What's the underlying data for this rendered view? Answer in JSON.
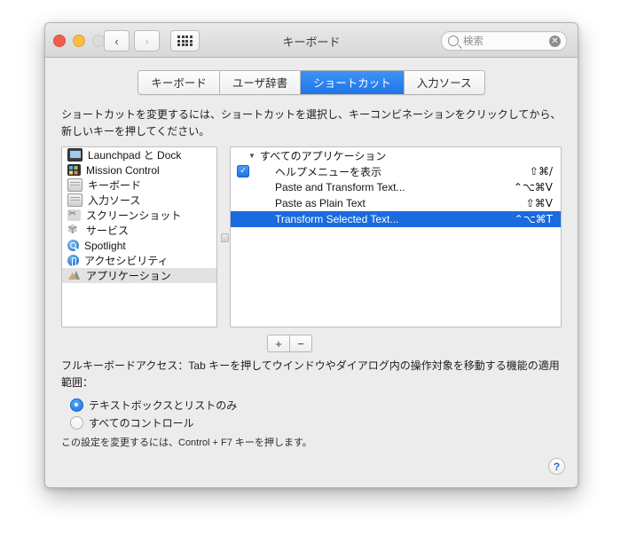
{
  "window": {
    "title": "キーボード",
    "traffic_lights": [
      "close",
      "minimize",
      "zoom"
    ],
    "nav": {
      "back_icon": "‹",
      "forward_icon": "›",
      "grid_icon": "grid-icon"
    },
    "search": {
      "placeholder": "検索",
      "value": "",
      "clear_label": "✕"
    }
  },
  "tabs": [
    {
      "label": "キーボード",
      "active": false
    },
    {
      "label": "ユーザ辞書",
      "active": false
    },
    {
      "label": "ショートカット",
      "active": true
    },
    {
      "label": "入力ソース",
      "active": false
    }
  ],
  "description": "ショートカットを変更するには、ショートカットを選択し、キーコンビネーションをクリックしてから、新しいキーを押してください。",
  "sidebar": {
    "items": [
      {
        "label": "Launchpad と Dock",
        "icon": "laptop-icon",
        "selected": false
      },
      {
        "label": "Mission Control",
        "icon": "mission-control-icon",
        "selected": false
      },
      {
        "label": "キーボード",
        "icon": "keyboard-icon",
        "selected": false
      },
      {
        "label": "入力ソース",
        "icon": "keyboard-icon",
        "selected": false
      },
      {
        "label": "スクリーンショット",
        "icon": "screenshot-icon",
        "selected": false
      },
      {
        "label": "サービス",
        "icon": "gear-icon",
        "selected": false
      },
      {
        "label": "Spotlight",
        "icon": "spotlight-icon",
        "selected": false
      },
      {
        "label": "アクセシビリティ",
        "icon": "accessibility-icon",
        "selected": false
      },
      {
        "label": "アプリケーション",
        "icon": "application-icon",
        "selected": true
      }
    ]
  },
  "shortcut_list": {
    "group_header": "すべてのアプリケーション",
    "disclosure_icon": "▼",
    "rows": [
      {
        "label": "ヘルプメニューを表示",
        "keys": "⇧⌘/",
        "checked": true,
        "selected": false
      },
      {
        "label": "Paste and Transform Text...",
        "keys": "⌃⌥⌘V",
        "checked": false,
        "selected": false
      },
      {
        "label": "Paste as Plain Text",
        "keys": "⇧⌘V",
        "checked": false,
        "selected": false
      },
      {
        "label": "Transform Selected Text...",
        "keys": "⌃⌥⌘T",
        "checked": false,
        "selected": true
      }
    ]
  },
  "list_buttons": {
    "add_label": "+",
    "remove_label": "−"
  },
  "full_keyboard_access": {
    "description": "フルキーボードアクセス：Tab キーを押してウインドウやダイアログ内の操作対象を移動する機能の適用範囲：",
    "options": [
      {
        "label": "テキストボックスとリストのみ",
        "selected": true
      },
      {
        "label": "すべてのコントロール",
        "selected": false
      }
    ],
    "hint": "この設定を変更するには、Control + F7 キーを押します。"
  },
  "help_button": {
    "label": "?"
  },
  "colors": {
    "accent_blue": "#1a6ae0",
    "tab_active_blue": "#2f7fef",
    "window_bg": "#ececec",
    "list_bg": "#ffffff",
    "sidebar_selection": "#e2e2e2"
  }
}
